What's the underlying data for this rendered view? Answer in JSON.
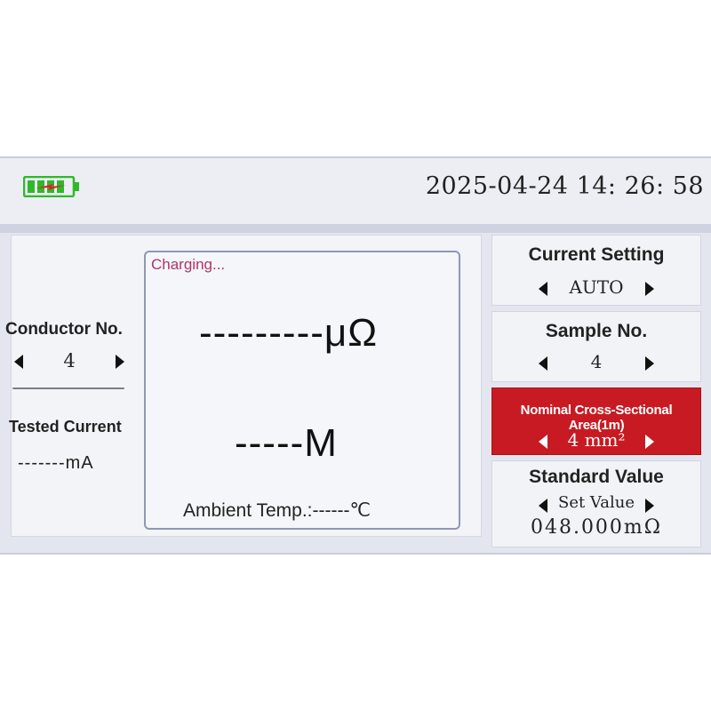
{
  "header": {
    "datetime": "2025-04-24 14: 26: 58",
    "battery_icon": "battery-charging-icon",
    "battery_color": "#2fb82a",
    "charge_color": "#e3202a"
  },
  "left": {
    "conductor_label": "Conductor No.",
    "conductor_value": "4",
    "tested_current_label": "Tested Current",
    "tested_current_value": "-------mA"
  },
  "center": {
    "status": "Charging...",
    "resistance_value": "---------μΩ",
    "length_value": "-----M",
    "ambient_temp": "Ambient Temp.:------℃"
  },
  "right": {
    "current_setting": {
      "label": "Current Setting",
      "value": "AUTO"
    },
    "sample_no": {
      "label": "Sample No.",
      "value": "4"
    },
    "cross_section": {
      "label": "Nominal Cross-Sectional Area(1m)",
      "value": "4 mm²",
      "highlight_color": "#c81a22"
    },
    "standard_value": {
      "label": "Standard Value",
      "set_label": "Set Value",
      "value": "048.000mΩ"
    }
  }
}
